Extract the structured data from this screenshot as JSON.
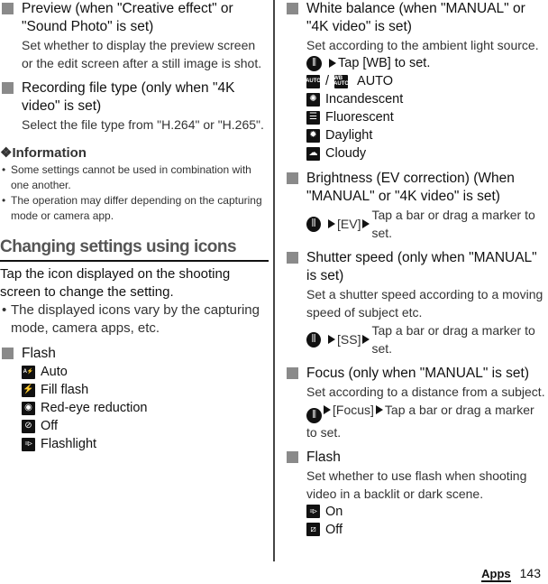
{
  "left": {
    "sections": [
      {
        "title": "Preview (when \"Creative effect\" or \"Sound Photo\" is set)",
        "body": "Set whether to display the preview screen or the edit screen after a still image is shot."
      },
      {
        "title": "Recording file type (only when \"4K video\" is set)",
        "body": "Select the file type from \"H.264\" or \"H.265\"."
      }
    ],
    "information": {
      "icon": "diamond-ornament-icon",
      "symbol": "❖",
      "title": "Information",
      "items": [
        "Some settings cannot be used in combination with one another.",
        "The operation may differ depending on the capturing mode or camera app."
      ]
    },
    "heading": "Changing settings using icons",
    "lead": "Tap the icon displayed on the shooting screen to change the setting.",
    "bullets": [
      "The displayed icons vary by the capturing mode, camera apps, etc."
    ],
    "flash": {
      "title": "Flash",
      "options": [
        {
          "icon": "flash-auto-icon",
          "glyph": "A⚡",
          "label": "Auto"
        },
        {
          "icon": "fill-flash-icon",
          "glyph": "⚡",
          "label": "Fill flash"
        },
        {
          "icon": "red-eye-icon",
          "glyph": "◉",
          "label": "Red-eye reduction"
        },
        {
          "icon": "flash-off-icon",
          "glyph": "⊘",
          "label": "Off"
        },
        {
          "icon": "flashlight-icon",
          "glyph": "≡▷",
          "label": "Flashlight"
        }
      ]
    }
  },
  "right": {
    "white_balance": {
      "title": "White balance (when \"MANUAL\" or \"4K video\" is set)",
      "body": "Set according to the ambient light source.",
      "instruction": "Tap [WB] to set.",
      "auto": {
        "icon1": "AUTO",
        "separator": "/",
        "icon2": "WB AUTO",
        "label": "AUTO"
      },
      "options": [
        {
          "icon": "incandescent-icon",
          "glyph": "✺",
          "label": "Incandescent"
        },
        {
          "icon": "fluorescent-icon",
          "glyph": "☰",
          "label": "Fluorescent"
        },
        {
          "icon": "daylight-icon",
          "glyph": "✹",
          "label": "Daylight"
        },
        {
          "icon": "cloudy-icon",
          "glyph": "☁",
          "label": "Cloudy"
        }
      ]
    },
    "brightness": {
      "title": "Brightness (EV correction) (When \"MANUAL\" or \"4K video\" is set)",
      "step1": "[EV]",
      "step2": "Tap a bar or drag a marker to set."
    },
    "shutter": {
      "title": "Shutter speed (only when \"MANUAL\" is set)",
      "body": "Set a shutter speed according to a moving speed of subject etc.",
      "step1": "[SS]",
      "step2": "Tap a bar or drag a marker to set."
    },
    "focus": {
      "title": "Focus (only when \"MANUAL\" is set)",
      "body": "Set according to a distance from a subject.",
      "step1": "[Focus]",
      "step2": "Tap a bar or drag a marker to set."
    },
    "flash": {
      "title": "Flash",
      "body": "Set whether to use flash when shooting video in a backlit or dark scene.",
      "options": [
        {
          "icon": "video-flash-on-icon",
          "glyph": "≡▷",
          "label": "On"
        },
        {
          "icon": "video-flash-off-icon",
          "glyph": "⧄",
          "label": "Off"
        }
      ]
    }
  },
  "footer": {
    "section": "Apps",
    "page_number": "143"
  }
}
